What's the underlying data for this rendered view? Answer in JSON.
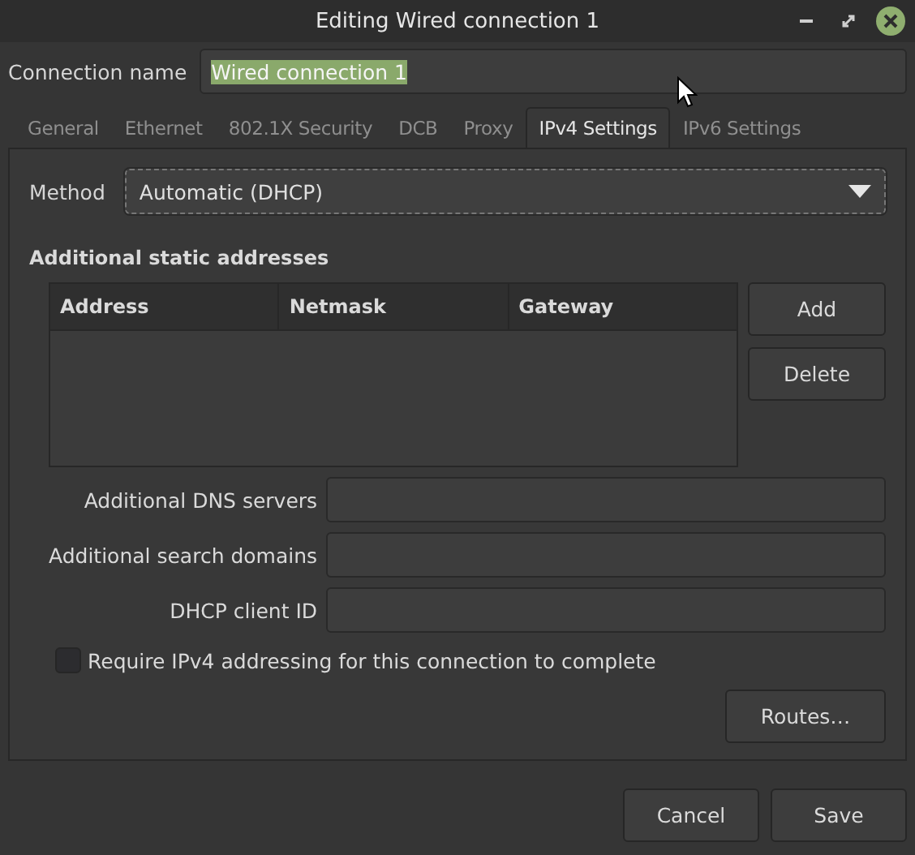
{
  "window": {
    "title": "Editing Wired connection 1"
  },
  "connection_name": {
    "label": "Connection name",
    "value": "Wired connection 1",
    "text_selected": true
  },
  "tabs": [
    {
      "label": "General",
      "selected": false
    },
    {
      "label": "Ethernet",
      "selected": false
    },
    {
      "label": "802.1X Security",
      "selected": false
    },
    {
      "label": "DCB",
      "selected": false
    },
    {
      "label": "Proxy",
      "selected": false
    },
    {
      "label": "IPv4 Settings",
      "selected": true
    },
    {
      "label": "IPv6 Settings",
      "selected": false
    }
  ],
  "method": {
    "label": "Method",
    "value": "Automatic (DHCP)"
  },
  "static_addresses": {
    "heading": "Additional static addresses",
    "columns": [
      "Address",
      "Netmask",
      "Gateway"
    ],
    "buttons": [
      "Add",
      "Delete"
    ]
  },
  "fields": [
    {
      "label": "Additional DNS servers"
    },
    {
      "label": "Additional search domains"
    },
    {
      "label": "DHCP client ID"
    }
  ],
  "require_ipv4": {
    "label": "Require IPv4 addressing for this connection to complete",
    "checked": false
  },
  "routes_button": "Routes…",
  "buttons": [
    "Cancel",
    "Save"
  ]
}
